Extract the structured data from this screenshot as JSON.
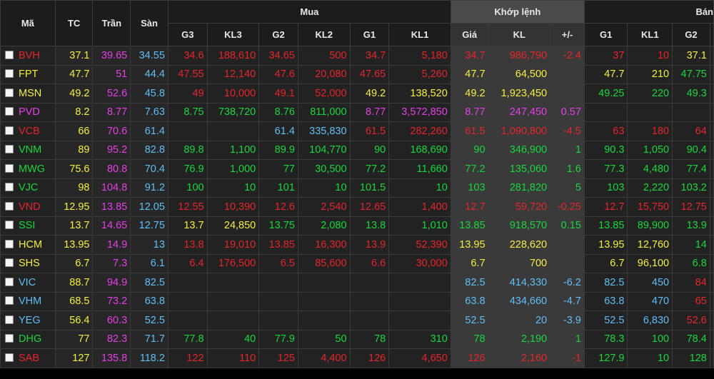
{
  "header": {
    "ma": "Mã",
    "tc": "TC",
    "tran": "Trần",
    "san": "Sàn",
    "mua": "Mua",
    "khop": "Khớp lệnh",
    "ban": "Bán",
    "g3": "G3",
    "kl3": "KL3",
    "g2": "G2",
    "kl2": "KL2",
    "g1": "G1",
    "kl1": "KL1",
    "gia": "Giá",
    "kl": "KL",
    "pm": "+/-",
    "bg1": "G1",
    "bkl1": "KL1",
    "bg2": "G2"
  },
  "colors": {
    "red": "#e5252a",
    "green": "#16d83b",
    "yellow": "#f2ef3c",
    "purple": "#e53ee8",
    "cyan": "#5fbff4"
  },
  "rows": [
    {
      "sym": "BVH",
      "sym_c": "red",
      "tc": "37.1",
      "tran": "39.65",
      "san": "34.55",
      "g3": "34.6",
      "g3_c": "red",
      "kl3": "188,610",
      "kl3_c": "red",
      "g2": "34.65",
      "g2_c": "red",
      "kl2": "500",
      "kl2_c": "red",
      "g1": "34.7",
      "g1_c": "red",
      "kl1": "5,180",
      "kl1_c": "red",
      "gia": "34.7",
      "gia_c": "red",
      "kl": "986,790",
      "kl_c": "red",
      "pm": "-2.4",
      "pm_c": "red",
      "bg1": "37",
      "bg1_c": "red",
      "bkl1": "10",
      "bkl1_c": "red",
      "bg2": "37.1",
      "bg2_c": "yellow"
    },
    {
      "sym": "FPT",
      "sym_c": "yellow",
      "tc": "47.7",
      "tran": "51",
      "san": "44.4",
      "g3": "47.55",
      "g3_c": "red",
      "kl3": "12,140",
      "kl3_c": "red",
      "g2": "47.6",
      "g2_c": "red",
      "kl2": "20,080",
      "kl2_c": "red",
      "g1": "47.65",
      "g1_c": "red",
      "kl1": "5,260",
      "kl1_c": "red",
      "gia": "47.7",
      "gia_c": "yellow",
      "kl": "64,500",
      "kl_c": "yellow",
      "pm": "",
      "pm_c": "yellow",
      "bg1": "47.7",
      "bg1_c": "yellow",
      "bkl1": "210",
      "bkl1_c": "yellow",
      "bg2": "47.75",
      "bg2_c": "green"
    },
    {
      "sym": "MSN",
      "sym_c": "yellow",
      "tc": "49.2",
      "tran": "52.6",
      "san": "45.8",
      "g3": "49",
      "g3_c": "red",
      "kl3": "10,000",
      "kl3_c": "red",
      "g2": "49.1",
      "g2_c": "red",
      "kl2": "52,000",
      "kl2_c": "red",
      "g1": "49.2",
      "g1_c": "yellow",
      "kl1": "138,520",
      "kl1_c": "yellow",
      "gia": "49.2",
      "gia_c": "yellow",
      "kl": "1,923,450",
      "kl_c": "yellow",
      "pm": "",
      "pm_c": "yellow",
      "bg1": "49.25",
      "bg1_c": "green",
      "bkl1": "220",
      "bkl1_c": "green",
      "bg2": "49.3",
      "bg2_c": "green"
    },
    {
      "sym": "PVD",
      "sym_c": "purple",
      "tc": "8.2",
      "tran": "8.77",
      "san": "7.63",
      "g3": "8.75",
      "g3_c": "green",
      "kl3": "738,720",
      "kl3_c": "green",
      "g2": "8.76",
      "g2_c": "green",
      "kl2": "811,000",
      "kl2_c": "green",
      "g1": "8.77",
      "g1_c": "purple",
      "kl1": "3,572,850",
      "kl1_c": "purple",
      "gia": "8.77",
      "gia_c": "purple",
      "kl": "247,450",
      "kl_c": "purple",
      "pm": "0.57",
      "pm_c": "purple",
      "bg1": "",
      "bg1_c": "green",
      "bkl1": "",
      "bkl1_c": "green",
      "bg2": "",
      "bg2_c": "green"
    },
    {
      "sym": "VCB",
      "sym_c": "red",
      "tc": "66",
      "tran": "70.6",
      "san": "61.4",
      "g3": "",
      "g3_c": "red",
      "kl3": "",
      "kl3_c": "red",
      "g2": "61.4",
      "g2_c": "cyan",
      "kl2": "335,830",
      "kl2_c": "cyan",
      "g1": "61.5",
      "g1_c": "red",
      "kl1": "282,260",
      "kl1_c": "red",
      "gia": "61.5",
      "gia_c": "red",
      "kl": "1,090,800",
      "kl_c": "red",
      "pm": "-4.5",
      "pm_c": "red",
      "bg1": "63",
      "bg1_c": "red",
      "bkl1": "180",
      "bkl1_c": "red",
      "bg2": "64",
      "bg2_c": "red"
    },
    {
      "sym": "VNM",
      "sym_c": "green",
      "tc": "89",
      "tran": "95.2",
      "san": "82.8",
      "g3": "89.8",
      "g3_c": "green",
      "kl3": "1,100",
      "kl3_c": "green",
      "g2": "89.9",
      "g2_c": "green",
      "kl2": "104,770",
      "kl2_c": "green",
      "g1": "90",
      "g1_c": "green",
      "kl1": "168,690",
      "kl1_c": "green",
      "gia": "90",
      "gia_c": "green",
      "kl": "346,900",
      "kl_c": "green",
      "pm": "1",
      "pm_c": "green",
      "bg1": "90.3",
      "bg1_c": "green",
      "bkl1": "1,050",
      "bkl1_c": "green",
      "bg2": "90.4",
      "bg2_c": "green"
    },
    {
      "sym": "MWG",
      "sym_c": "green",
      "tc": "75.6",
      "tran": "80.8",
      "san": "70.4",
      "g3": "76.9",
      "g3_c": "green",
      "kl3": "1,000",
      "kl3_c": "green",
      "g2": "77",
      "g2_c": "green",
      "kl2": "30,500",
      "kl2_c": "green",
      "g1": "77.2",
      "g1_c": "green",
      "kl1": "11,660",
      "kl1_c": "green",
      "gia": "77.2",
      "gia_c": "green",
      "kl": "135,060",
      "kl_c": "green",
      "pm": "1.6",
      "pm_c": "green",
      "bg1": "77.3",
      "bg1_c": "green",
      "bkl1": "4,480",
      "bkl1_c": "green",
      "bg2": "77.4",
      "bg2_c": "green"
    },
    {
      "sym": "VJC",
      "sym_c": "green",
      "tc": "98",
      "tran": "104.8",
      "san": "91.2",
      "g3": "100",
      "g3_c": "green",
      "kl3": "10",
      "kl3_c": "green",
      "g2": "101",
      "g2_c": "green",
      "kl2": "10",
      "kl2_c": "green",
      "g1": "101.5",
      "g1_c": "green",
      "kl1": "10",
      "kl1_c": "green",
      "gia": "103",
      "gia_c": "green",
      "kl": "281,820",
      "kl_c": "green",
      "pm": "5",
      "pm_c": "green",
      "bg1": "103",
      "bg1_c": "green",
      "bkl1": "2,220",
      "bkl1_c": "green",
      "bg2": "103.2",
      "bg2_c": "green"
    },
    {
      "sym": "VND",
      "sym_c": "red",
      "tc": "12.95",
      "tran": "13.85",
      "san": "12.05",
      "g3": "12.55",
      "g3_c": "red",
      "kl3": "10,390",
      "kl3_c": "red",
      "g2": "12.6",
      "g2_c": "red",
      "kl2": "2,540",
      "kl2_c": "red",
      "g1": "12.65",
      "g1_c": "red",
      "kl1": "1,400",
      "kl1_c": "red",
      "gia": "12.7",
      "gia_c": "red",
      "kl": "59,720",
      "kl_c": "red",
      "pm": "-0.25",
      "pm_c": "red",
      "bg1": "12.7",
      "bg1_c": "red",
      "bkl1": "15,750",
      "bkl1_c": "red",
      "bg2": "12.75",
      "bg2_c": "red"
    },
    {
      "sym": "SSI",
      "sym_c": "green",
      "tc": "13.7",
      "tran": "14.65",
      "san": "12.75",
      "g3": "13.7",
      "g3_c": "yellow",
      "kl3": "24,850",
      "kl3_c": "yellow",
      "g2": "13.75",
      "g2_c": "green",
      "kl2": "2,080",
      "kl2_c": "green",
      "g1": "13.8",
      "g1_c": "green",
      "kl1": "1,010",
      "kl1_c": "green",
      "gia": "13.85",
      "gia_c": "green",
      "kl": "918,570",
      "kl_c": "green",
      "pm": "0.15",
      "pm_c": "green",
      "bg1": "13.85",
      "bg1_c": "green",
      "bkl1": "89,900",
      "bkl1_c": "green",
      "bg2": "13.9",
      "bg2_c": "green"
    },
    {
      "sym": "HCM",
      "sym_c": "yellow",
      "tc": "13.95",
      "tran": "14.9",
      "san": "13",
      "g3": "13.8",
      "g3_c": "red",
      "kl3": "19,010",
      "kl3_c": "red",
      "g2": "13.85",
      "g2_c": "red",
      "kl2": "16,300",
      "kl2_c": "red",
      "g1": "13.9",
      "g1_c": "red",
      "kl1": "52,390",
      "kl1_c": "red",
      "gia": "13.95",
      "gia_c": "yellow",
      "kl": "228,620",
      "kl_c": "yellow",
      "pm": "",
      "pm_c": "yellow",
      "bg1": "13.95",
      "bg1_c": "yellow",
      "bkl1": "12,760",
      "bkl1_c": "yellow",
      "bg2": "14",
      "bg2_c": "green"
    },
    {
      "sym": "SHS",
      "sym_c": "yellow",
      "tc": "6.7",
      "tran": "7.3",
      "san": "6.1",
      "g3": "6.4",
      "g3_c": "red",
      "kl3": "176,500",
      "kl3_c": "red",
      "g2": "6.5",
      "g2_c": "red",
      "kl2": "85,600",
      "kl2_c": "red",
      "g1": "6.6",
      "g1_c": "red",
      "kl1": "30,000",
      "kl1_c": "red",
      "gia": "6.7",
      "gia_c": "yellow",
      "kl": "700",
      "kl_c": "yellow",
      "pm": "",
      "pm_c": "yellow",
      "bg1": "6.7",
      "bg1_c": "yellow",
      "bkl1": "96,100",
      "bkl1_c": "yellow",
      "bg2": "6.8",
      "bg2_c": "green"
    },
    {
      "sym": "VIC",
      "sym_c": "cyan",
      "tc": "88.7",
      "tran": "94.9",
      "san": "82.5",
      "g3": "",
      "g3_c": "red",
      "kl3": "",
      "kl3_c": "red",
      "g2": "",
      "g2_c": "red",
      "kl2": "",
      "kl2_c": "red",
      "g1": "",
      "g1_c": "red",
      "kl1": "",
      "kl1_c": "red",
      "gia": "82.5",
      "gia_c": "cyan",
      "kl": "414,330",
      "kl_c": "cyan",
      "pm": "-6.2",
      "pm_c": "cyan",
      "bg1": "82.5",
      "bg1_c": "cyan",
      "bkl1": "450",
      "bkl1_c": "cyan",
      "bg2": "84",
      "bg2_c": "red"
    },
    {
      "sym": "VHM",
      "sym_c": "cyan",
      "tc": "68.5",
      "tran": "73.2",
      "san": "63.8",
      "g3": "",
      "g3_c": "red",
      "kl3": "",
      "kl3_c": "red",
      "g2": "",
      "g2_c": "red",
      "kl2": "",
      "kl2_c": "red",
      "g1": "",
      "g1_c": "red",
      "kl1": "",
      "kl1_c": "red",
      "gia": "63.8",
      "gia_c": "cyan",
      "kl": "434,660",
      "kl_c": "cyan",
      "pm": "-4.7",
      "pm_c": "cyan",
      "bg1": "63.8",
      "bg1_c": "cyan",
      "bkl1": "470",
      "bkl1_c": "cyan",
      "bg2": "65",
      "bg2_c": "red"
    },
    {
      "sym": "YEG",
      "sym_c": "cyan",
      "tc": "56.4",
      "tran": "60.3",
      "san": "52.5",
      "g3": "",
      "g3_c": "red",
      "kl3": "",
      "kl3_c": "red",
      "g2": "",
      "g2_c": "red",
      "kl2": "",
      "kl2_c": "red",
      "g1": "",
      "g1_c": "red",
      "kl1": "",
      "kl1_c": "red",
      "gia": "52.5",
      "gia_c": "cyan",
      "kl": "20",
      "kl_c": "cyan",
      "pm": "-3.9",
      "pm_c": "cyan",
      "bg1": "52.5",
      "bg1_c": "cyan",
      "bkl1": "6,830",
      "bkl1_c": "cyan",
      "bg2": "52.6",
      "bg2_c": "red"
    },
    {
      "sym": "DHG",
      "sym_c": "green",
      "tc": "77",
      "tran": "82.3",
      "san": "71.7",
      "g3": "77.8",
      "g3_c": "green",
      "kl3": "40",
      "kl3_c": "green",
      "g2": "77.9",
      "g2_c": "green",
      "kl2": "50",
      "kl2_c": "green",
      "g1": "78",
      "g1_c": "green",
      "kl1": "310",
      "kl1_c": "green",
      "gia": "78",
      "gia_c": "green",
      "kl": "2,190",
      "kl_c": "green",
      "pm": "1",
      "pm_c": "green",
      "bg1": "78.3",
      "bg1_c": "green",
      "bkl1": "100",
      "bkl1_c": "green",
      "bg2": "78.4",
      "bg2_c": "green"
    },
    {
      "sym": "SAB",
      "sym_c": "red",
      "tc": "127",
      "tran": "135.8",
      "san": "118.2",
      "g3": "122",
      "g3_c": "red",
      "kl3": "110",
      "kl3_c": "red",
      "g2": "125",
      "g2_c": "red",
      "kl2": "4,400",
      "kl2_c": "red",
      "g1": "126",
      "g1_c": "red",
      "kl1": "4,650",
      "kl1_c": "red",
      "gia": "126",
      "gia_c": "red",
      "kl": "2,160",
      "kl_c": "red",
      "pm": "-1",
      "pm_c": "red",
      "bg1": "127.9",
      "bg1_c": "green",
      "bkl1": "10",
      "bkl1_c": "green",
      "bg2": "128",
      "bg2_c": "green"
    }
  ]
}
